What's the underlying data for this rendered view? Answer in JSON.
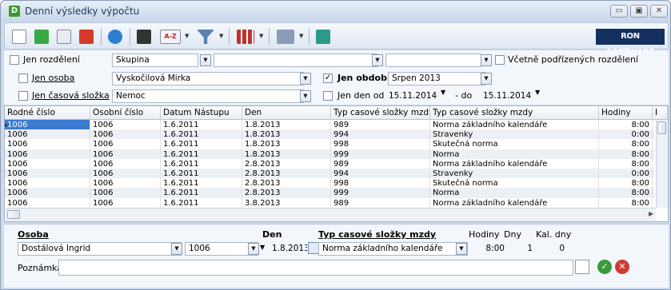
{
  "window": {
    "title": "Denní výsledky výpočtu",
    "app_letter": "D"
  },
  "brand": {
    "logo_text": "RON SOFTWARE"
  },
  "toolbar": {
    "sort_label": "A-Z"
  },
  "filters": {
    "jen_rozdeleni": {
      "label": "Jen rozdělení",
      "value": "Skupina",
      "checked": false
    },
    "vcetne": {
      "label": "Včetně podřízených rozdělení",
      "checked": false
    },
    "jen_osoba": {
      "label": "Jen osoba",
      "value": "Vyskočilová Mirka",
      "checked": false
    },
    "jen_obdobi": {
      "label": "Jen období",
      "value": "Srpen 2013",
      "checked": true,
      "check_mark": "✓"
    },
    "jen_casova": {
      "label": "Jen časová složka",
      "value": "Nemoc",
      "checked": false
    },
    "jen_den": {
      "label": "Jen den od",
      "from": "15.11.2014",
      "to_label": "- do",
      "to": "15.11.2014",
      "checked": false
    }
  },
  "grid": {
    "columns": [
      "Rodné číslo",
      "Osobní číslo",
      "Datum Nástupu",
      "Den",
      "Typ casové složky mzdy (kód)",
      "Typ casové složky mzdy",
      "Hodiny",
      "I"
    ],
    "rows": [
      [
        "1006",
        "1006",
        "1.6.2011",
        "1.8.2013",
        "989",
        "Norma základního kalendáře",
        "8:00"
      ],
      [
        "1006",
        "1006",
        "1.6.2011",
        "1.8.2013",
        "994",
        "Stravenky",
        "0:00"
      ],
      [
        "1006",
        "1006",
        "1.6.2011",
        "1.8.2013",
        "998",
        "Skutečná norma",
        "8:00"
      ],
      [
        "1006",
        "1006",
        "1.6.2011",
        "1.8.2013",
        "999",
        "Norma",
        "8:00"
      ],
      [
        "1006",
        "1006",
        "1.6.2011",
        "2.8.2013",
        "989",
        "Norma základního kalendáře",
        "8:00"
      ],
      [
        "1006",
        "1006",
        "1.6.2011",
        "2.8.2013",
        "994",
        "Stravenky",
        "0:00"
      ],
      [
        "1006",
        "1006",
        "1.6.2011",
        "2.8.2013",
        "998",
        "Skutečná norma",
        "8:00"
      ],
      [
        "1006",
        "1006",
        "1.6.2011",
        "2.8.2013",
        "999",
        "Norma",
        "8:00"
      ],
      [
        "1006",
        "1006",
        "1.6.2011",
        "3.8.2013",
        "989",
        "Norma základního kalendáře",
        "8:00"
      ]
    ],
    "current_row_marker": "▶"
  },
  "detail": {
    "osoba_label": "Osoba",
    "osoba_value": "Dostálová Ingrid",
    "osoba_num": "1006",
    "den_label": "Den",
    "den_value": "1.8.2013",
    "typ_label": "Typ casové složky mzdy",
    "typ_value": "Norma základního kalendáře",
    "hodiny_label": "Hodiny",
    "hodiny_value": "8:00",
    "dny_label": "Dny",
    "dny_value": "1",
    "kal_label": "Kal. dny",
    "kal_value": "0",
    "poznamka_label": "Poznámka",
    "poznamka_value": ""
  }
}
